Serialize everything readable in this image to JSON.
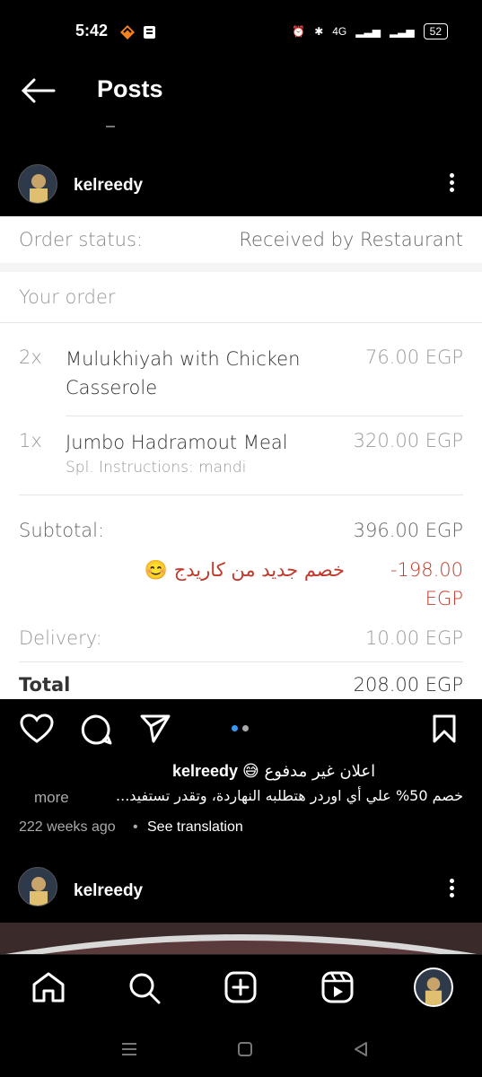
{
  "status_bar": {
    "time": "5:42",
    "network": "4G",
    "battery": "52"
  },
  "header": {
    "title": "Posts"
  },
  "post1": {
    "username": "kelreedy",
    "receipt": {
      "order_status_label": "Order status:",
      "order_status_value": "Received by Restaurant",
      "your_order_label": "Your order",
      "items": [
        {
          "qty": "2x",
          "name_line1": "Mulukhiyah with Chicken",
          "name_line2": "Casserole",
          "price": "76.00 EGP"
        },
        {
          "qty": "1x",
          "name_line1": "Jumbo Hadramout Meal",
          "instructions": "Spl. Instructions: mandi",
          "price": "320.00 EGP"
        }
      ],
      "subtotal_label": "Subtotal:",
      "subtotal_value": "396.00 EGP",
      "discount_text": "خصم جديد من كاريدج 😊",
      "discount_value_line1": "-198.00",
      "discount_value_line2": "EGP",
      "delivery_label": "Delivery:",
      "delivery_value": "10.00 EGP",
      "total_label": "Total",
      "total_value": "208.00 EGP"
    },
    "caption_username": "kelreedy",
    "caption_line1": "اعلان غير مدفوع 😅",
    "caption_line2": "خصم 50% علي أي اوردر هتطلبه النهاردة، وتقدر تستفيد...",
    "more_label": "more",
    "time_ago": "222 weeks ago",
    "separator": "•",
    "see_translation": "See translation"
  },
  "post2": {
    "username": "kelreedy"
  },
  "colors": {
    "background": "#000000",
    "discount_red": "#c0392b",
    "carousel_active": "#3897f0"
  }
}
